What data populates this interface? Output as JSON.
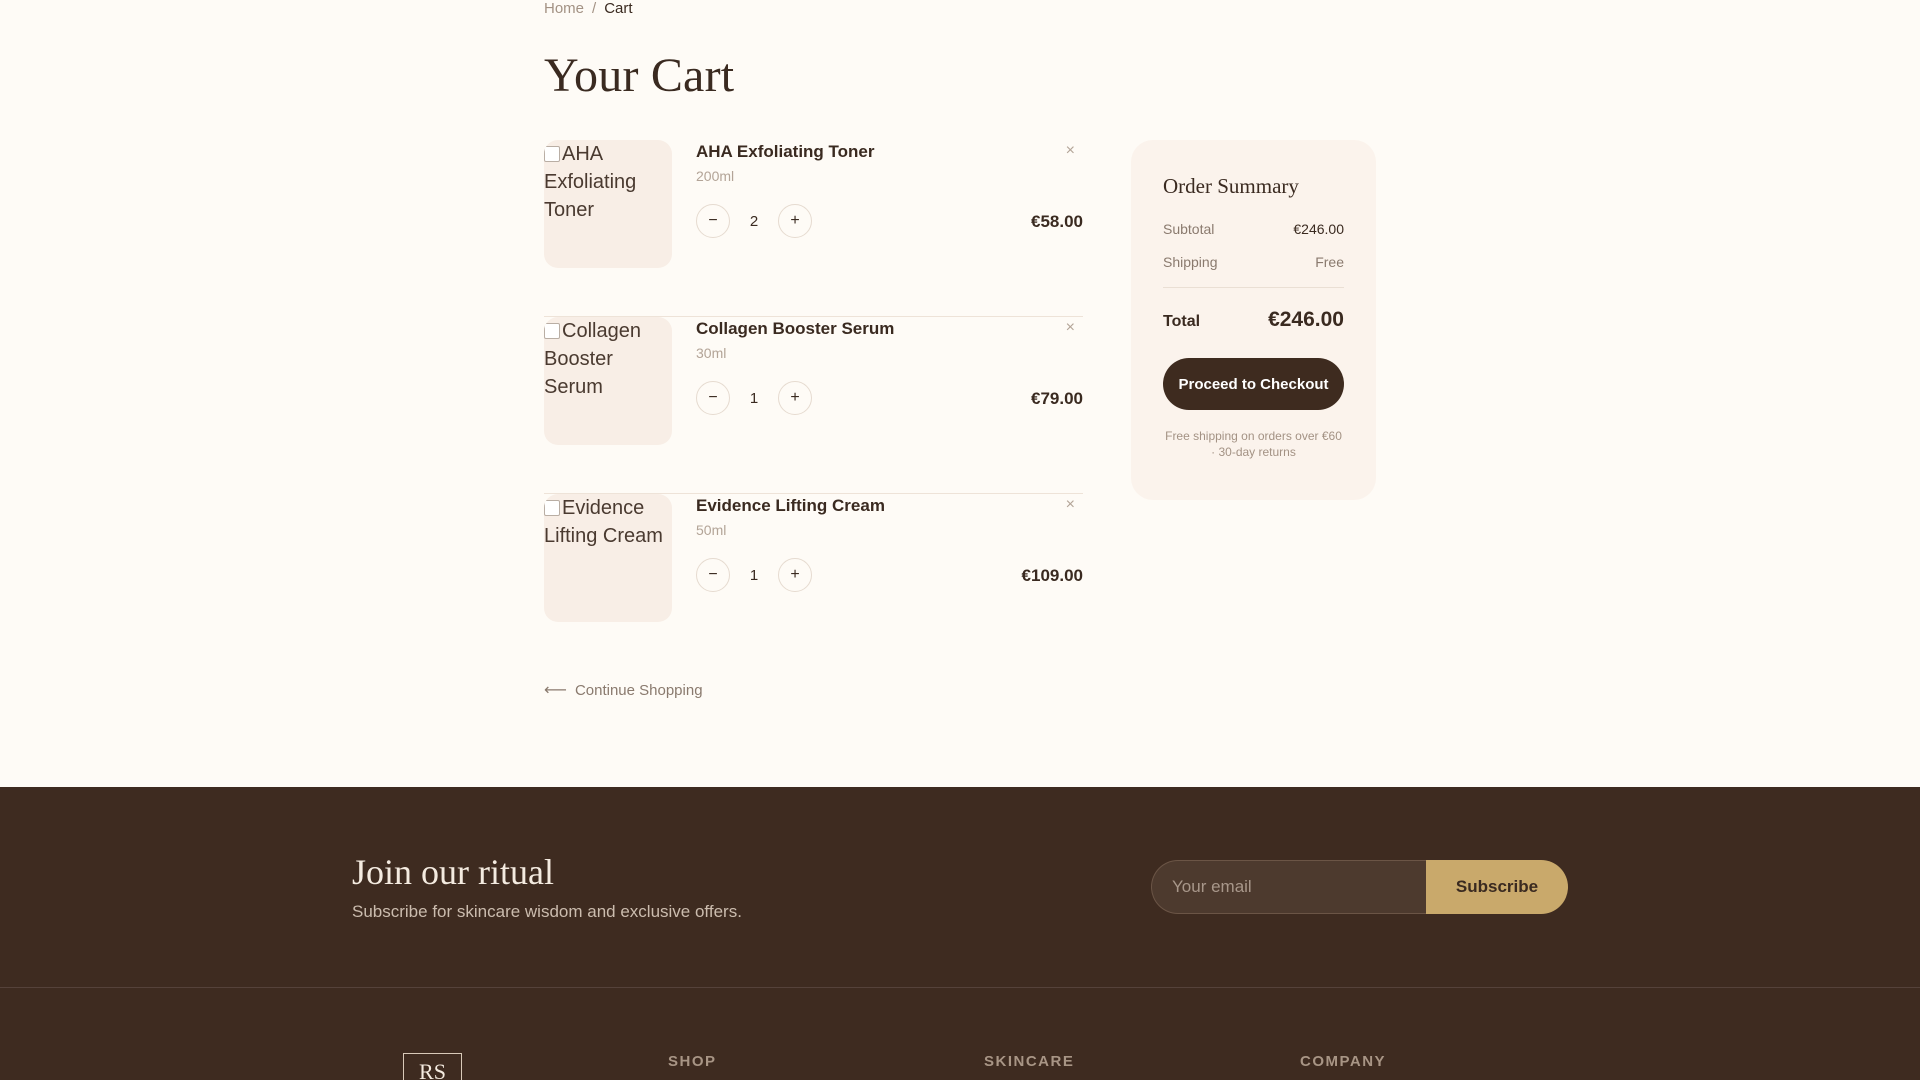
{
  "breadcrumb": {
    "home": "Home",
    "separator": "/",
    "current": "Cart"
  },
  "page": {
    "title": "Your Cart"
  },
  "cart": {
    "items": [
      {
        "thumb_alt": "AHA Exfoliating Toner",
        "name": "AHA Exfoliating Toner",
        "size": "200ml",
        "quantity": "2",
        "price": "€58.00",
        "remove": "×"
      },
      {
        "thumb_alt": "Collagen Booster Serum",
        "name": "Collagen Booster Serum",
        "size": "30ml",
        "quantity": "1",
        "price": "€79.00",
        "remove": "×"
      },
      {
        "thumb_alt": "Evidence Lifting Cream",
        "name": "Evidence Lifting Cream",
        "size": "50ml",
        "quantity": "1",
        "price": "€109.00",
        "remove": "×"
      }
    ],
    "decrement": "−",
    "increment": "+",
    "continue_arrow": "⟵",
    "continue_label": "Continue Shopping"
  },
  "summary": {
    "title": "Order Summary",
    "subtotal_label": "Subtotal",
    "subtotal_value": "€246.00",
    "shipping_label": "Shipping",
    "shipping_value": "Free",
    "total_label": "Total",
    "total_value": "€246.00",
    "checkout_label": "Proceed to Checkout",
    "note": "Free shipping on orders over €60 · 30-day returns"
  },
  "footer": {
    "newsletter_title": "Join our ritual",
    "newsletter_sub": "Subscribe for skincare wisdom and exclusive offers.",
    "email_placeholder": "Your email",
    "subscribe_label": "Subscribe",
    "logo": "RS",
    "columns": [
      "SHOP",
      "SKINCARE",
      "COMPANY"
    ]
  },
  "colors": {
    "background": "#fefbf6",
    "footer": "#3e2b20",
    "accent_gold": "#c9a96b",
    "button_dark": "#3e2b1f"
  }
}
